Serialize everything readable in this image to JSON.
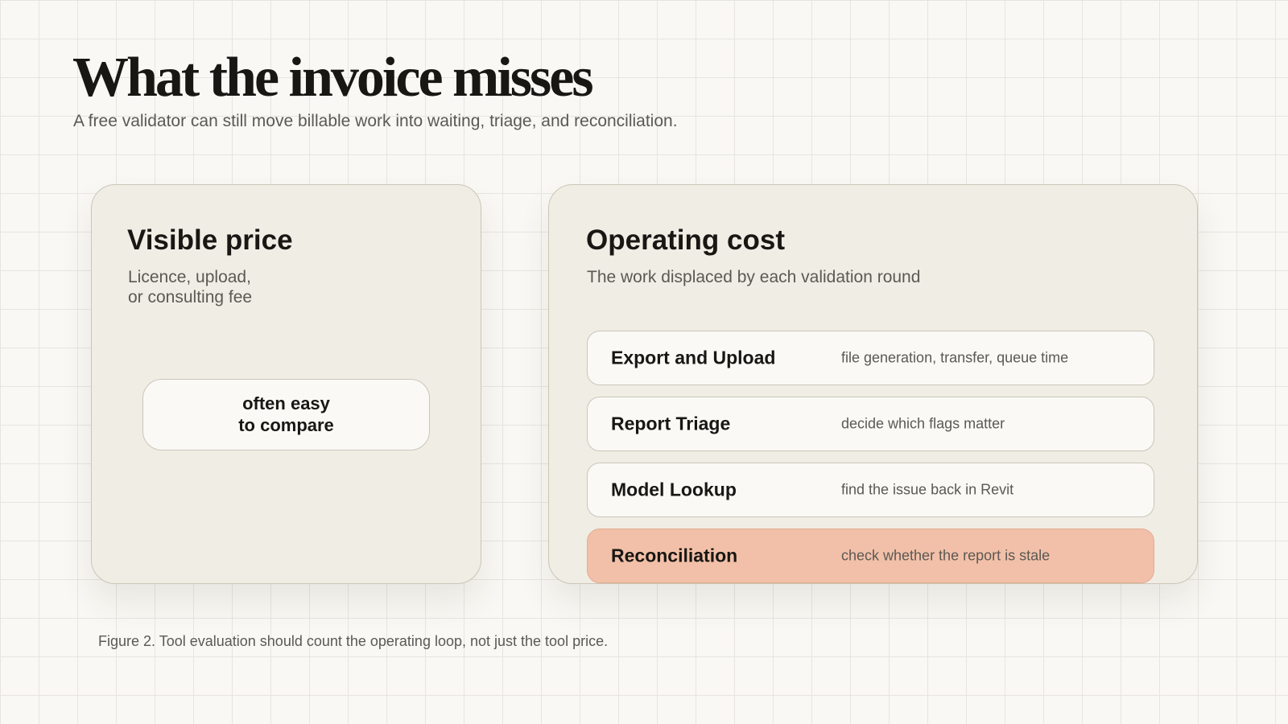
{
  "title": "What the invoice misses",
  "subtitle": "A free validator can still move billable work into waiting, triage, and reconciliation.",
  "visible_price": {
    "heading": "Visible price",
    "description_lines": [
      "Licence, upload,",
      "or consulting fee"
    ],
    "pill_lines": [
      "often easy",
      "to compare"
    ]
  },
  "operating_cost": {
    "heading": "Operating cost",
    "description": "The work displaced by each validation round",
    "rows": [
      {
        "label": "Export and Upload",
        "description": "file generation, transfer, queue time",
        "highlighted": false
      },
      {
        "label": "Report Triage",
        "description": "decide which flags matter",
        "highlighted": false
      },
      {
        "label": "Model Lookup",
        "description": "find the issue back in Revit",
        "highlighted": false
      },
      {
        "label": "Reconciliation",
        "description": "check whether the report is stale",
        "highlighted": true
      }
    ]
  },
  "caption": "Figure 2. Tool evaluation should count the operating loop, not just the tool price.",
  "colors": {
    "background": "#f9f8f4",
    "grid": "#e7e5de",
    "card": "#f0ede5",
    "card_border": "#cbc6b6",
    "row": "#faf9f5",
    "highlight": "#f2c0a8",
    "text_primary": "#181714",
    "text_secondary": "#5b5953"
  }
}
